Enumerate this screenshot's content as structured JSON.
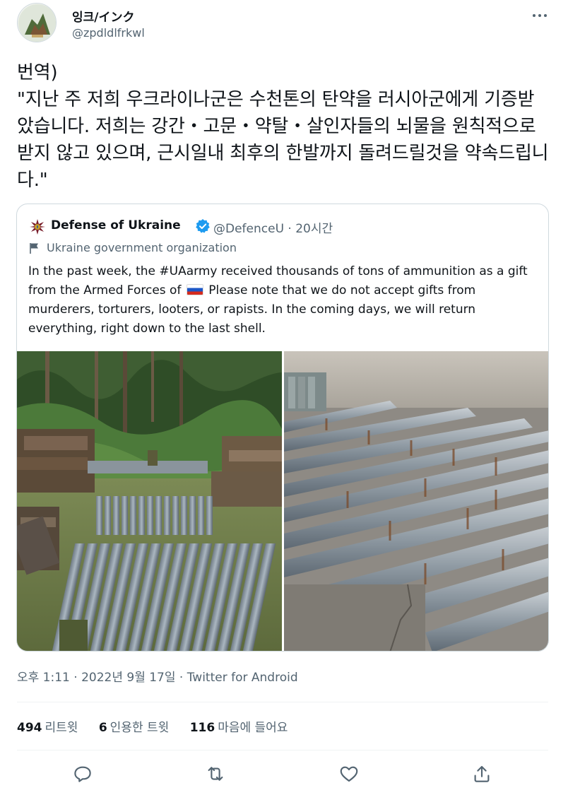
{
  "author": {
    "display_name": "잉크/インク",
    "handle": "@zpdldlfrkwl",
    "avatar_icon": "avatar-image"
  },
  "tweet": {
    "text": "번역)\n\"지난 주 저희 우크라이나군은 수천톤의 탄약을 러시아군에게 기증받았습니다. 저희는 강간・고문・약탈・살인자들의 뇌물을 원칙적으로 받지 않고 있으며, 근시일내 최후의 한발까지 돌려드릴것을 약속드립니다.\""
  },
  "quoted_tweet": {
    "name": "Defense of Ukraine",
    "handle_time": "@DefenceU · 20시간",
    "label": "Ukraine government organization",
    "text_part1": "In the past week, the #UAarmy received thousands of tons of ammunition as a gift from the Armed Forces of",
    "text_part2": "Please note that we do not accept gifts from murderers, torturers, looters, or rapists. In the coming days, we will return everything, right down to the last shell.",
    "inline_flag_icon": "russia-flag-emoji",
    "verified_color": "#1d9bf0"
  },
  "meta": {
    "timestamp": "오후 1:11 · 2022년 9월 17일 · Twitter for Android"
  },
  "stats": {
    "retweets_count": "494",
    "retweets_label": "리트윗",
    "quotes_count": "6",
    "quotes_label": "인용한 트윗",
    "likes_count": "116",
    "likes_label": "마음에 들어요"
  },
  "actions": [
    "reply-icon",
    "retweet-icon",
    "like-icon",
    "share-icon"
  ],
  "colors": {
    "text_primary": "#0f1419",
    "text_secondary": "#536471",
    "border": "#cfd9de",
    "accent": "#1d9bf0"
  }
}
